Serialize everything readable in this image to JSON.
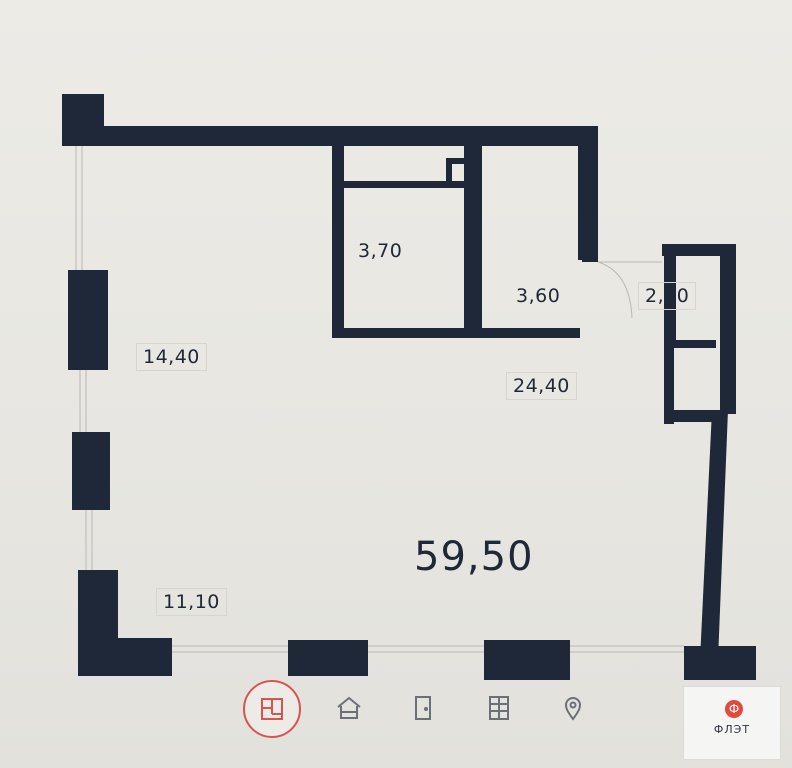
{
  "plan": {
    "total_area": "59,50",
    "rooms": [
      {
        "id": "bath-small",
        "label": "3,70"
      },
      {
        "id": "bath-right",
        "label": "3,60"
      },
      {
        "id": "balcony",
        "label": "2,30"
      },
      {
        "id": "living-left",
        "label": "14,40"
      },
      {
        "id": "kitchen",
        "label": "24,40"
      },
      {
        "id": "bedroom-bottom",
        "label": "11,10"
      }
    ]
  },
  "nav": {
    "items": [
      {
        "name": "floorplan",
        "icon": "floorplan-icon",
        "active": true
      },
      {
        "name": "house",
        "icon": "house-icon",
        "active": false
      },
      {
        "name": "door",
        "icon": "door-icon",
        "active": false
      },
      {
        "name": "building",
        "icon": "building-icon",
        "active": false
      },
      {
        "name": "location",
        "icon": "location-pin-icon",
        "active": false
      }
    ],
    "active_color": "#d9534f"
  },
  "brand": {
    "logo_letter": "Ф",
    "name": "ФЛЭТ",
    "color": "#e04b3c"
  },
  "colors": {
    "wall": "#1f2838",
    "background": "#ecebe6"
  }
}
